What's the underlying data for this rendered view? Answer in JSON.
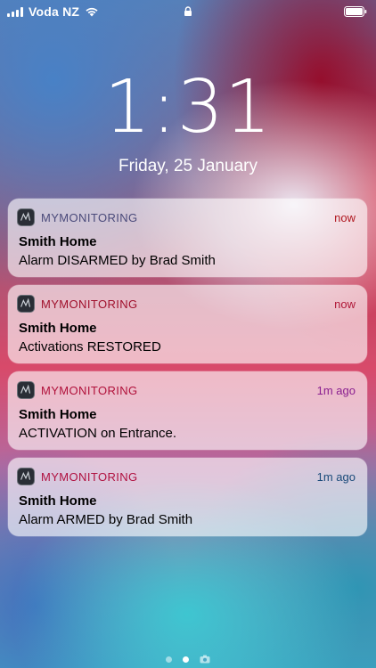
{
  "status_bar": {
    "carrier": "Voda NZ"
  },
  "lock_screen": {
    "time": "1:31",
    "date": "Friday, 25 January"
  },
  "notifications": [
    {
      "app": "MYMONITORING",
      "time": "now",
      "title": "Smith Home",
      "body": "Alarm DISARMED by Brad Smith",
      "app_color": "#4a4a7a",
      "time_color": "#b01820"
    },
    {
      "app": "MYMONITORING",
      "time": "now",
      "title": "Smith Home",
      "body": "Activations RESTORED",
      "app_color": "#a0102c",
      "time_color": "#b01838"
    },
    {
      "app": "MYMONITORING",
      "time": "1m ago",
      "title": "Smith Home",
      "body": "ACTIVATION on Entrance.",
      "app_color": "#b0103a",
      "time_color": "#8a2090"
    },
    {
      "app": "MYMONITORING",
      "time": "1m ago",
      "title": "Smith Home",
      "body": "Alarm ARMED by Brad Smith",
      "app_color": "#b01040",
      "time_color": "#1a4a7a"
    }
  ],
  "page_indicator": {
    "pages": 3,
    "current": 2
  }
}
